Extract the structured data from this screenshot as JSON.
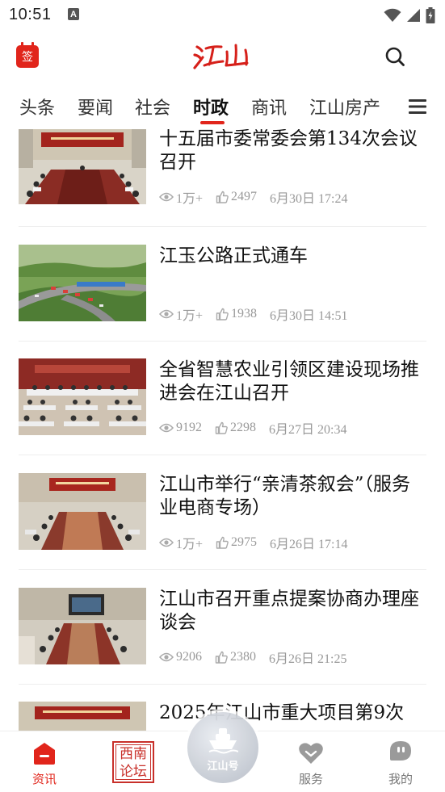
{
  "status": {
    "time": "10:51",
    "notif_letter": "A"
  },
  "header": {
    "sign_label": "签",
    "logo_text": "江山"
  },
  "tabs": [
    {
      "label": "头条",
      "active": false
    },
    {
      "label": "要闻",
      "active": false
    },
    {
      "label": "社会",
      "active": false
    },
    {
      "label": "时政",
      "active": true
    },
    {
      "label": "商讯",
      "active": false
    },
    {
      "label": "江山房产",
      "active": false
    }
  ],
  "news": [
    {
      "title": "十五届市委常委会第134次会议召开",
      "views": "1万+",
      "likes": "2497",
      "date": "6月30日  17:24",
      "thumb": "meeting"
    },
    {
      "title": "江玉公路正式通车",
      "views": "1万+",
      "likes": "1938",
      "date": "6月30日  14:51",
      "thumb": "road"
    },
    {
      "title": "全省智慧农业引领区建设现场推进会在江山召开",
      "views": "9192",
      "likes": "2298",
      "date": "6月27日  20:34",
      "thumb": "conference"
    },
    {
      "title": "江山市举行“亲清茶叙会”（服务业电商专场）",
      "views": "1万+",
      "likes": "2975",
      "date": "6月26日  17:14",
      "thumb": "meeting"
    },
    {
      "title": "江山市召开重点提案协商办理座谈会",
      "views": "9206",
      "likes": "2380",
      "date": "6月26日  21:25",
      "thumb": "roundtable"
    },
    {
      "title": "2025年江山市重大项目第9次",
      "views": "",
      "likes": "",
      "date": "",
      "thumb": "meeting"
    }
  ],
  "bottom_nav": {
    "news_label": "资讯",
    "forum_line1": "西南",
    "forum_line2": "论坛",
    "center_label": "江山号",
    "service_label": "服务",
    "mine_label": "我的"
  },
  "colors": {
    "accent": "#e1251b",
    "muted_text": "#999999"
  }
}
